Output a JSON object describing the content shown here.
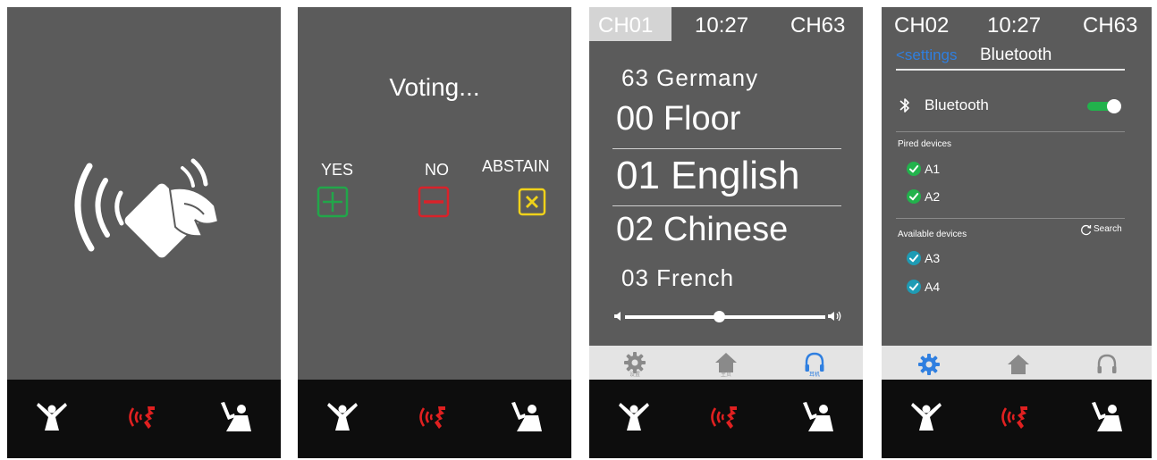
{
  "colors": {
    "panel_bg": "#5b5b5b",
    "bottom_bar_bg": "#0d0d0d",
    "speak_red": "#e02020",
    "yes_green": "#22a64a",
    "no_red": "#d9222a",
    "abstain_yellow": "#f0d21a",
    "accent_blue": "#2f7fe0",
    "check_green": "#22b24c",
    "check_teal": "#1e9bb4",
    "tabbar_bg": "#e4e4e4"
  },
  "bottom_bar": {
    "icons": [
      "raise-hand-icon",
      "speak-request-icon",
      "chairman-icon"
    ]
  },
  "screen_card": {
    "icons": [
      "nfc-card-icon"
    ]
  },
  "screen_voting": {
    "title": "Voting...",
    "options": [
      {
        "label": "YES",
        "icon": "plus-icon"
      },
      {
        "label": "NO",
        "icon": "minus-icon"
      },
      {
        "label": "ABSTAIN",
        "icon": "x-icon"
      }
    ]
  },
  "screen_channels": {
    "header": {
      "left": "CH01",
      "time": "10:27",
      "right": "CH63"
    },
    "channels": [
      {
        "label": "63 Germany"
      },
      {
        "label": "00 Floor"
      },
      {
        "label": "01 English",
        "selected": true
      },
      {
        "label": "02 Chinese"
      },
      {
        "label": "03 French"
      }
    ],
    "volume": 0.47,
    "tabs": [
      {
        "icon": "gear-icon",
        "label": "设置"
      },
      {
        "icon": "home-icon",
        "label": "主页"
      },
      {
        "icon": "headphones-icon",
        "label": "耳机"
      }
    ]
  },
  "screen_bluetooth": {
    "header": {
      "left": "CH02",
      "time": "10:27",
      "right": "CH63"
    },
    "back_label": "<settings",
    "title": "Bluetooth",
    "toggle_label": "Bluetooth",
    "toggle_on": true,
    "paired_header": "Pired devices",
    "paired": [
      "A1",
      "A2"
    ],
    "available_header": "Available devices",
    "search_label": "Search",
    "available": [
      "A3",
      "A4"
    ],
    "tabs": [
      {
        "icon": "gear-icon"
      },
      {
        "icon": "home-icon"
      },
      {
        "icon": "headphones-icon"
      }
    ]
  }
}
